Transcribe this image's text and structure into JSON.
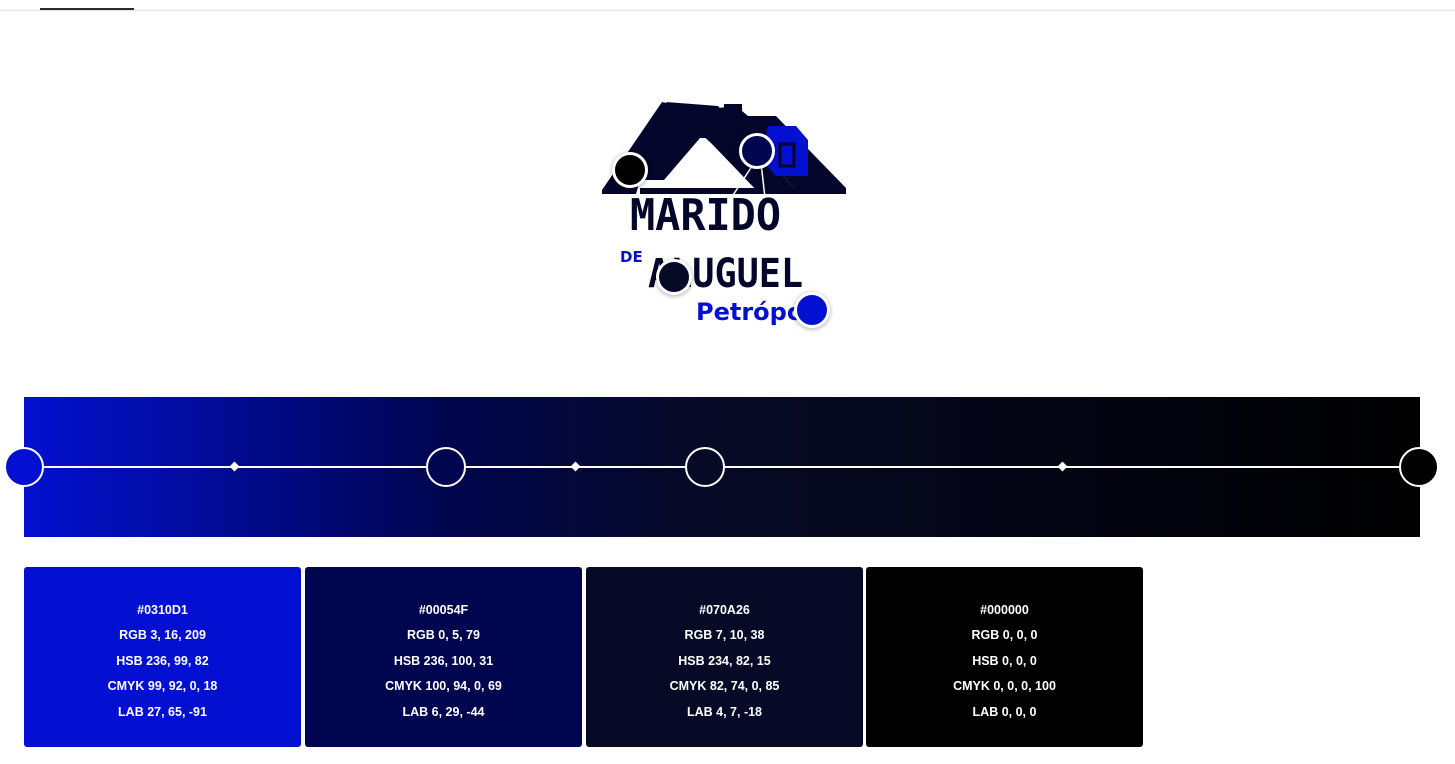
{
  "logo": {
    "line1": "MARIDO",
    "de": "DE",
    "line2": "ALUGUEL",
    "city": "Petrópc",
    "colors": {
      "dark": "#03052a",
      "blue": "#0310d1"
    }
  },
  "pickers": [
    {
      "name": "picker-black",
      "color": "#000000"
    },
    {
      "name": "picker-navy",
      "color": "#00054F"
    },
    {
      "name": "picker-dark-navy",
      "color": "#070A26"
    },
    {
      "name": "picker-blue",
      "color": "#0310D1"
    }
  ],
  "gradient": {
    "stops": [
      {
        "color": "#0310D1",
        "position": 0.0
      },
      {
        "color": "#00054F",
        "position": 0.3
      },
      {
        "color": "#070A26",
        "position": 0.485
      },
      {
        "color": "#000000",
        "position": 1.0
      }
    ]
  },
  "swatches": [
    {
      "hex": "#0310D1",
      "rgb": "RGB 3, 16, 209",
      "hsb": "HSB 236, 99, 82",
      "cmyk": "CMYK 99, 92, 0, 18",
      "lab": "LAB 27, 65, -91",
      "color": "#0310D1"
    },
    {
      "hex": "#00054F",
      "rgb": "RGB 0, 5, 79",
      "hsb": "HSB 236, 100, 31",
      "cmyk": "CMYK 100, 94, 0, 69",
      "lab": "LAB 6, 29, -44",
      "color": "#00054F"
    },
    {
      "hex": "#070A26",
      "rgb": "RGB 7, 10, 38",
      "hsb": "HSB 234, 82, 15",
      "cmyk": "CMYK 82, 74, 0, 85",
      "lab": "LAB 4, 7, -18",
      "color": "#070A26"
    },
    {
      "hex": "#000000",
      "rgb": "RGB 0, 0, 0",
      "hsb": "HSB 0, 0, 0",
      "cmyk": "CMYK 0, 0, 0, 100",
      "lab": "LAB 0, 0, 0",
      "color": "#000000"
    }
  ]
}
